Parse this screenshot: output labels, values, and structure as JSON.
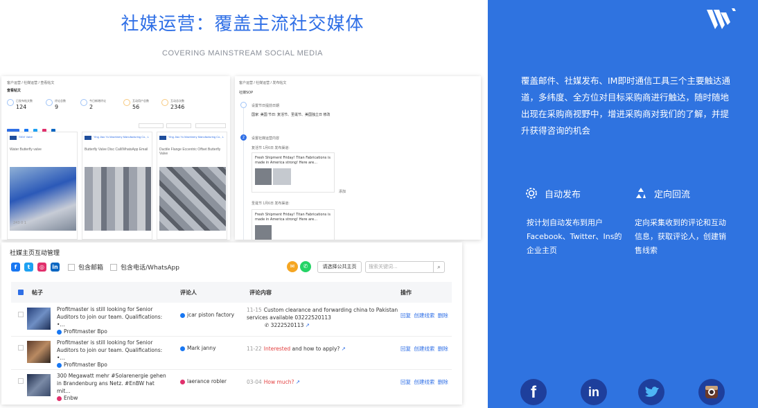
{
  "header": {
    "title": "社媒运营：覆盖主流社交媒体",
    "subtitle": "COVERING MAINSTREAM SOCIAL MEDIA"
  },
  "screen1": {
    "breadcrumb": "客户运营 / 社媒运营 / 查看帖文",
    "section": "查看帖文",
    "stats": [
      {
        "label": "已发布帖文数",
        "value": "124"
      },
      {
        "label": "评论总数",
        "value": "9"
      },
      {
        "label": "今日新增评论",
        "value": "2"
      },
      {
        "label": "互动用户总数",
        "value": "56"
      },
      {
        "label": "互动总次数",
        "value": "2346"
      }
    ],
    "cards": [
      {
        "name": "SNVI Valve",
        "text": "Water Butterfly valve",
        "footer": "243   0   1"
      },
      {
        "name": "Ying Jiao Yu Machinery Manufacturing Co., L",
        "text": "Butterfly Valve Disc  Call/WhatsApp  Email",
        "footer": ""
      },
      {
        "name": "Ying Jiao Yu Machinery Manufacturing Co., L",
        "text": "Ductile Flange Eccentric Offset Butterfly Valve",
        "footer": ""
      }
    ]
  },
  "screen2": {
    "breadcrumb": "客户运营 / 社媒运营 / 发布帖文",
    "title": "社媒SOP",
    "step1_title": "设置节日提前日期",
    "step1_detail": "国家: 美国  节日: 复活节、圣诞节、美国独立日  修改",
    "step2_title": "设置社媒运营内容",
    "row_a": "复活节  1月6日     发布渠道:",
    "row_b": "圣诞节  1月6日     发布渠道:",
    "post_text": "Fresh Shipment Friday! Titan Fabrications is made in America strong! Here are...",
    "add": "添加"
  },
  "screen3": {
    "title": "社媒主页互动管理",
    "include_email": "包含邮箱",
    "include_phone": "包含电话/WhatsApp",
    "select_page_button": "请选择公共主页",
    "search_placeholder": "搜索关键词...",
    "columns": [
      "帖子",
      "评论人",
      "评论内容",
      "操作"
    ],
    "rows": [
      {
        "post": "Profitmaster is still looking for Senior Auditors to join our team. Qualifications: •...",
        "page": "Profitmaster Bpo",
        "page_platform": "facebook",
        "reviewer": "jcar piston factory",
        "reviewer_platform": "facebook",
        "date": "11-15",
        "comment": "Custom clearance and forwarding china to Pakistan services available 03222520113",
        "comment_extra": "3222520113",
        "ops": "回复 创建线索 删除"
      },
      {
        "post": "Profitmaster is still looking for Senior Auditors to join our team. Qualifications: •...",
        "page": "Profitmaster Bpo",
        "page_platform": "facebook",
        "reviewer": "Mark janny",
        "reviewer_platform": "facebook",
        "date": "11-22",
        "comment_red": "Interested",
        "comment": "and how to apply?",
        "ops": "回复 创建线索 删除"
      },
      {
        "post": "300 Megawatt mehr #Solarenergie gehen in Brandenburg ans Netz. #EnBW hat mit...",
        "page": "Enbw",
        "page_platform": "instagram",
        "reviewer": "laerance robler",
        "reviewer_platform": "instagram",
        "date": "03-04",
        "comment_red": "How much?",
        "comment": "",
        "ops": "回复 创建线索 删除"
      }
    ]
  },
  "right": {
    "intro": "覆盖邮件、社媒发布、IM即时通信工具三个主要触达通道，多纬度、全方位对目标采购商进行触达，随时随地出现在采购商视野中，增进采购商对我们的了解，并提升获得咨询的机会",
    "feature1_title": "自动发布",
    "feature1_desc": "按计划自动发布到用户Facebook、Twitter、Ins的企业主页",
    "feature2_title": "定向回流",
    "feature2_desc": "定向采集收到的评论和互动信息，获取评论人，创建销售线索",
    "social": [
      "f",
      "in"
    ]
  },
  "colors": {
    "brand_blue": "#2f73e0",
    "title_blue": "#2f6fe6",
    "facebook": "#1877f2",
    "instagram": "#e1306c",
    "link_red": "#e23e3e"
  }
}
